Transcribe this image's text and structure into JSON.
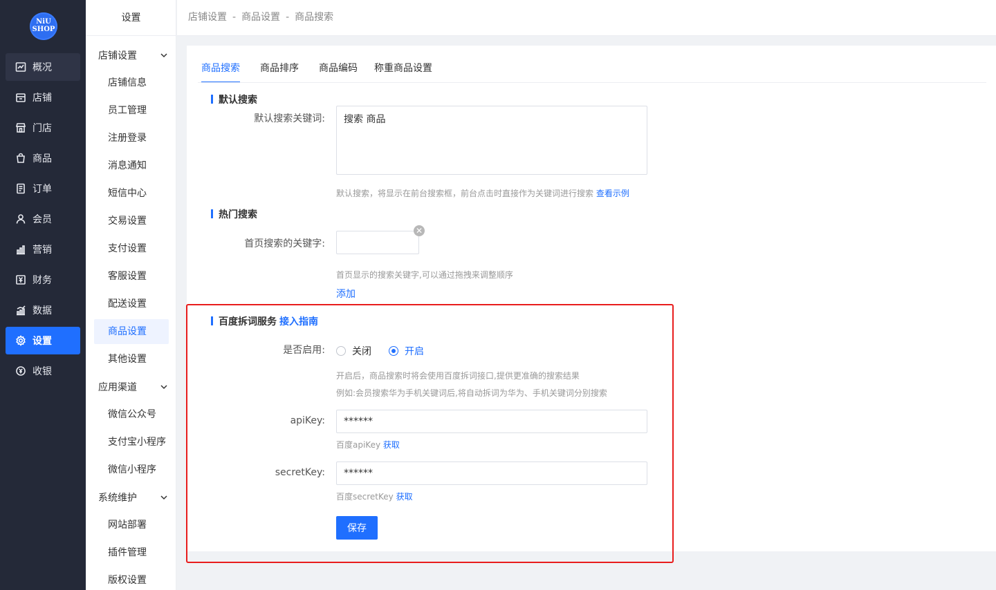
{
  "logo": {
    "line1": "NiU",
    "line2": "SHOP"
  },
  "nav": {
    "items": [
      {
        "label": "概况",
        "icon": "dashboard-icon"
      },
      {
        "label": "店铺",
        "icon": "store-icon"
      },
      {
        "label": "门店",
        "icon": "shop-icon"
      },
      {
        "label": "商品",
        "icon": "goods-icon"
      },
      {
        "label": "订单",
        "icon": "order-icon"
      },
      {
        "label": "会员",
        "icon": "member-icon"
      },
      {
        "label": "营销",
        "icon": "marketing-icon"
      },
      {
        "label": "财务",
        "icon": "finance-icon"
      },
      {
        "label": "数据",
        "icon": "data-icon"
      },
      {
        "label": "设置",
        "icon": "settings-icon"
      },
      {
        "label": "收银",
        "icon": "cashier-icon"
      }
    ]
  },
  "sub": {
    "title": "设置",
    "groups": [
      "店铺设置",
      "应用渠道",
      "系统维护"
    ],
    "items": [
      "店铺信息",
      "员工管理",
      "注册登录",
      "消息通知",
      "短信中心",
      "交易设置",
      "支付设置",
      "客服设置",
      "配送设置",
      "商品设置",
      "其他设置",
      "微信公众号",
      "支付宝小程序",
      "微信小程序",
      "网站部署",
      "插件管理",
      "版权设置"
    ]
  },
  "breadcrumb": [
    "店铺设置",
    "商品设置",
    "商品搜索"
  ],
  "breadcrumb_sep": "-",
  "tabs": [
    "商品搜索",
    "商品排序",
    "商品编码",
    "称重商品设置"
  ],
  "default_search": {
    "title": "默认搜索",
    "label": "默认搜索关键词:",
    "value": "搜索 商品",
    "hint": "默认搜索，将显示在前台搜索框，前台点击时直接作为关键词进行搜索",
    "hint_link": "查看示例"
  },
  "hot_search": {
    "title": "热门搜索",
    "label": "首页搜索的关键字:",
    "keyword_value": "",
    "close_glyph": "✕",
    "hint": "首页显示的搜索关键字,可以通过拖拽来调整顺序",
    "add_label": "添加"
  },
  "baidu": {
    "title": "百度拆词服务",
    "guide_link": "接入指南",
    "enable_label": "是否启用:",
    "options": [
      "关闭",
      "开启"
    ],
    "selected": "开启",
    "hint1": "开启后，商品搜索时将会使用百度拆词接口,提供更准确的搜索结果",
    "hint2": "例如:会员搜索华为手机关键词后,将自动拆词为华为、手机关键词分别搜索",
    "api_key_label": "apiKey:",
    "api_key_value": "******",
    "api_key_hint": "百度apiKey",
    "secret_key_label": "secretKey:",
    "secret_key_value": "******",
    "secret_key_hint": "百度secretKey",
    "get_link": "获取",
    "save_label": "保存"
  },
  "colors": {
    "accent": "#1f6fff",
    "nav_bg": "#242938",
    "highlight_box": "#e81c1c"
  }
}
